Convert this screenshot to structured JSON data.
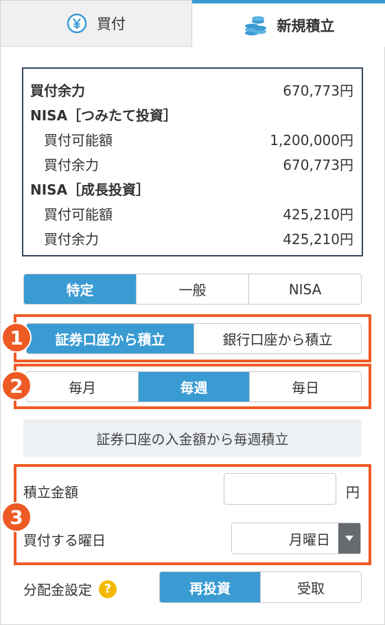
{
  "tabs": {
    "buy": {
      "label": "買付",
      "icon": "yen-coin-icon"
    },
    "new_savings": {
      "label": "新規積立",
      "icon": "coin-stack-icon",
      "active": true
    }
  },
  "balance": {
    "purchasing_power": {
      "label": "買付余力",
      "value": "670,773円"
    },
    "nisa_tsumitate": {
      "heading": "NISA［つみたて投資］",
      "limit": {
        "label": "買付可能額",
        "value": "1,200,000円"
      },
      "remaining": {
        "label": "買付余力",
        "value": "670,773円"
      }
    },
    "nisa_growth": {
      "heading": "NISA［成長投資］",
      "limit": {
        "label": "買付可能額",
        "value": "425,210円"
      },
      "remaining": {
        "label": "買付余力",
        "value": "425,210円"
      }
    }
  },
  "account_type": {
    "options": [
      "特定",
      "一般",
      "NISA"
    ],
    "selected": "特定"
  },
  "funding_source": {
    "options": [
      "証券口座から積立",
      "銀行口座から積立"
    ],
    "selected": "証券口座から積立"
  },
  "frequency": {
    "options": [
      "毎月",
      "毎週",
      "毎日"
    ],
    "selected": "毎週"
  },
  "info_text": "証券口座の入金額から毎週積立",
  "form": {
    "amount_label": "積立金額",
    "amount_value": "",
    "amount_unit": "円",
    "weekday_label": "買付する曜日",
    "weekday_value": "月曜日"
  },
  "distribution": {
    "label": "分配金設定",
    "help_icon": "?",
    "options": [
      "再投資",
      "受取"
    ],
    "selected": "再投資"
  },
  "annotations": {
    "badge1": "1",
    "badge2": "2",
    "badge3": "3"
  },
  "colors": {
    "accent": "#3a9bd3",
    "highlight": "#ee5a24",
    "help": "#f2b900",
    "border_dark": "#37475a"
  }
}
